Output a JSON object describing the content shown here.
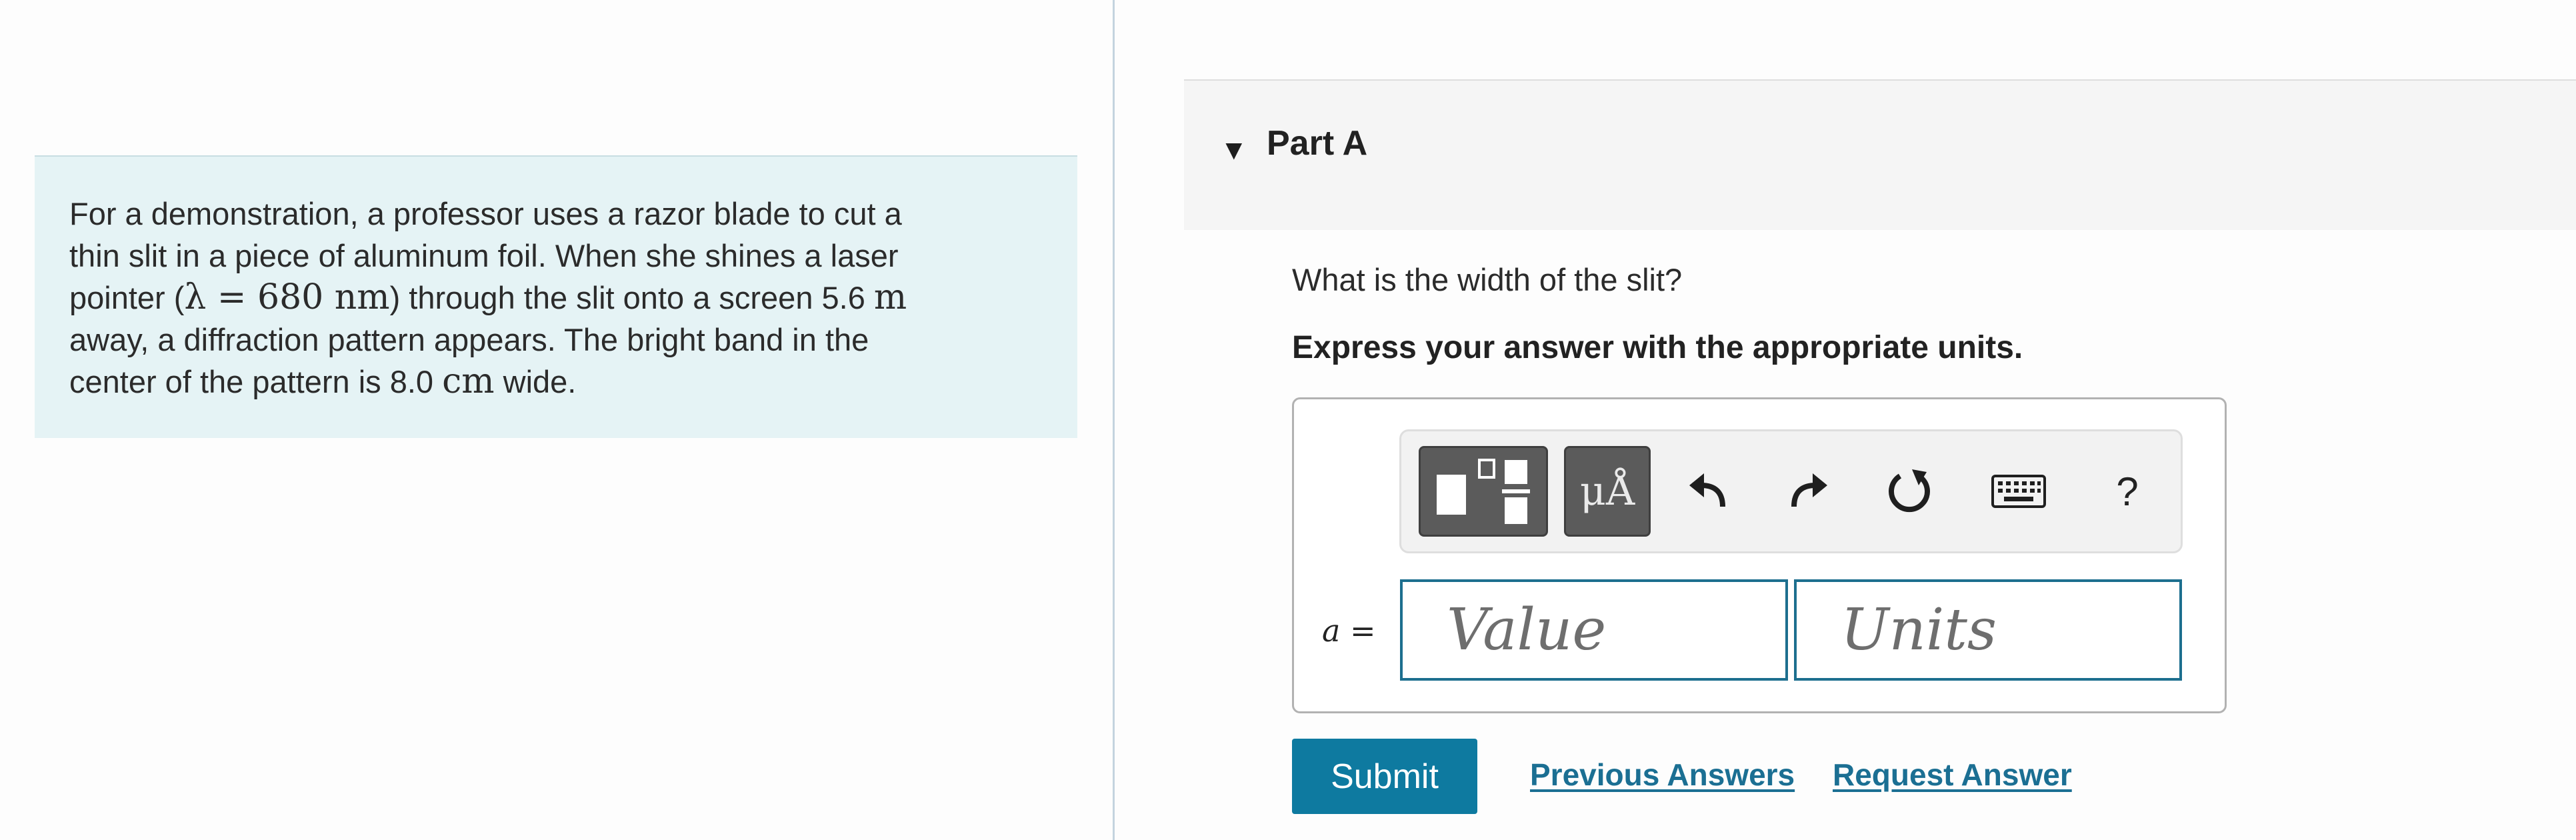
{
  "problem": {
    "line1": "For a demonstration, a professor uses a razor blade to cut a",
    "line2": "thin slit in a piece of aluminum foil. When she shines a laser",
    "line3_pre": "pointer (",
    "line3_math": "λ = 680 nm",
    "line3_mid": ") through the slit onto a screen 5.6 ",
    "line3_unit": "m",
    "line4": "away, a diffraction pattern appears. The bright band in the",
    "line5_pre": "center of the pattern is 8.0 ",
    "line5_unit": "cm",
    "line5_post": " wide."
  },
  "part": {
    "title": "Part A",
    "question": "What is the width of the slit?",
    "instruction": "Express your answer with the appropriate units."
  },
  "toolbar": {
    "units_label": "μÅ",
    "help_label": "?",
    "icons": [
      "templates-icon",
      "units-icon",
      "undo-icon",
      "redo-icon",
      "reset-icon",
      "keyboard-icon",
      "help-icon"
    ]
  },
  "answer": {
    "variable": "a",
    "equals": " =",
    "value_placeholder": "Value",
    "units_placeholder": "Units"
  },
  "actions": {
    "submit_label": "Submit",
    "previous_answers_label": "Previous Answers",
    "request_answer_label": "Request Answer"
  },
  "colors": {
    "problem_bg": "#e5f3f5",
    "accent": "#0e7aa0",
    "link": "#1b6f93",
    "field_border": "#1d6f8f"
  }
}
